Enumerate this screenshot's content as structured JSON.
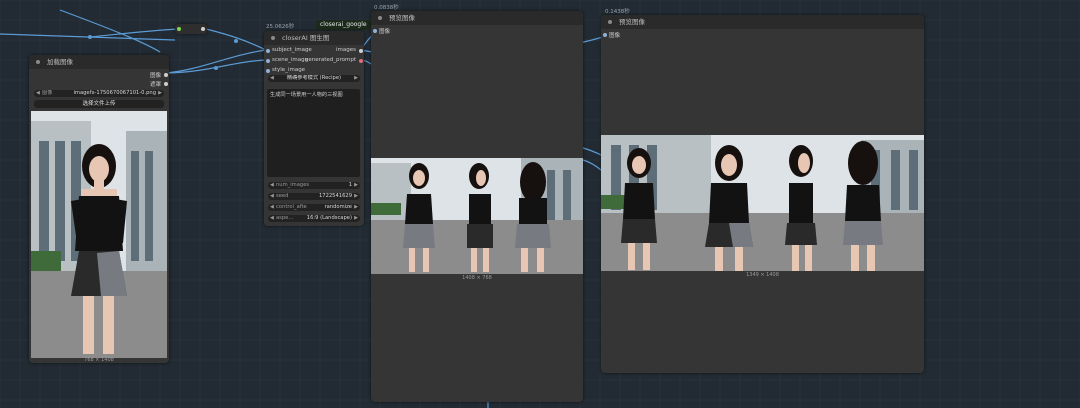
{
  "canvas": {
    "background": "#222b33",
    "grid_color": "#28323b",
    "wire_color": "#5b9bd5",
    "reroute_node_label": "closerai_google"
  },
  "load_image_node": {
    "title": "加载图像",
    "outputs": [
      "图像",
      "遮罩"
    ],
    "image_widget_label": "图像",
    "image_filename": "imagefx-1750670067101-0.png",
    "upload_button": "选择文件上传",
    "dims": "768 × 1408"
  },
  "closerai_node": {
    "exec_time": "25.0626秒",
    "title": "closerAI 图生图",
    "inputs": [
      "subject_image",
      "scene_image",
      "style_image"
    ],
    "outputs": [
      "images",
      "generated_prompt"
    ],
    "mode_value": "精确参考模式 (Recipe)",
    "prompt_text": "生成同一场景用一人物的三视图",
    "widgets": [
      {
        "name": "num_images",
        "value": "1"
      },
      {
        "name": "seed",
        "value": "1722541629"
      },
      {
        "name": "control_afte",
        "value": "randomize"
      },
      {
        "name": "aspe…",
        "value": "16:9 (Landscape)"
      }
    ]
  },
  "preview_node_1": {
    "exec_time": "0.0838秒",
    "title": "预览图像",
    "input": "图像",
    "dims": "1408 × 768"
  },
  "preview_node_2": {
    "exec_time": "0.1438秒",
    "title": "预览图像",
    "input": "图像",
    "dims": "1349 × 1408"
  },
  "photo_colors": {
    "sky": "#dde3e6",
    "building": "#b8c0c4",
    "glass": "#5e6e78",
    "tree": "#3f6a3a",
    "ground": "#8c8c8c",
    "skin": "#e8c6b4",
    "hair": "#16110f",
    "top": "#121212",
    "skirt_black": "#2a2a2a",
    "skirt_plaid": "#777a80"
  }
}
